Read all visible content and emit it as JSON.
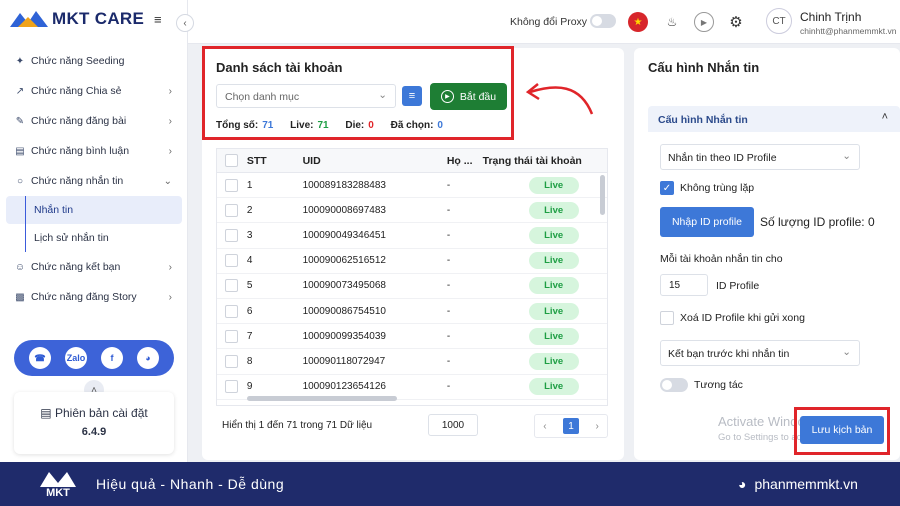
{
  "app": {
    "name": "MKT CARE"
  },
  "sidebar": {
    "items": [
      {
        "label": "Chức năng Seeding",
        "icon": "seeding-icon"
      },
      {
        "label": "Chức năng Chia sẻ",
        "icon": "share-icon"
      },
      {
        "label": "Chức năng đăng bài",
        "icon": "post-icon"
      },
      {
        "label": "Chức năng bình luận",
        "icon": "comment-icon"
      },
      {
        "label": "Chức năng nhắn tin",
        "icon": "message-icon"
      },
      {
        "label": "Chức năng kết bạn",
        "icon": "add-friend-icon"
      },
      {
        "label": "Chức năng đăng Story",
        "icon": "story-icon"
      }
    ],
    "sub_items": [
      {
        "label": "Nhắn tin"
      },
      {
        "label": "Lịch sử nhắn tin"
      }
    ],
    "version_label": "Phiên bản cài đặt",
    "version": "6.4.9"
  },
  "topbar": {
    "proxy_label": "Không đổi Proxy",
    "avatar_initials": "CT",
    "user_name": "Chinh Trịnh",
    "user_email": "chinhtt@phanmemmkt.vn"
  },
  "accounts": {
    "title": "Danh sách tài khoản",
    "category_placeholder": "Chọn danh mục",
    "start_label": "Bắt đầu",
    "stats": {
      "total_label": "Tổng số:",
      "total": "71",
      "live_label": "Live:",
      "live": "71",
      "die_label": "Die:",
      "die": "0",
      "selected_label": "Đã chọn:",
      "selected": "0"
    },
    "columns": [
      "STT",
      "UID",
      "Họ ...",
      "Trạng thái tài khoản"
    ],
    "rows": [
      {
        "stt": "1",
        "uid": "100089183288483",
        "name": "-",
        "status": "Live"
      },
      {
        "stt": "2",
        "uid": "100090008697483",
        "name": "-",
        "status": "Live"
      },
      {
        "stt": "3",
        "uid": "100090049346451",
        "name": "-",
        "status": "Live"
      },
      {
        "stt": "4",
        "uid": "100090062516512",
        "name": "-",
        "status": "Live"
      },
      {
        "stt": "5",
        "uid": "100090073495068",
        "name": "-",
        "status": "Live"
      },
      {
        "stt": "6",
        "uid": "100090086754510",
        "name": "-",
        "status": "Live"
      },
      {
        "stt": "7",
        "uid": "100090099354039",
        "name": "-",
        "status": "Live"
      },
      {
        "stt": "8",
        "uid": "100090118072947",
        "name": "-",
        "status": "Live"
      },
      {
        "stt": "9",
        "uid": "100090123654126",
        "name": "-",
        "status": "Live"
      }
    ],
    "footer_text": "Hiển thị 1 đến 71 trong 71 Dữ liệu",
    "page_size": "1000",
    "current_page": "1"
  },
  "config": {
    "title": "Cấu hình Nhắn tin",
    "section_title": "Cấu hình Nhắn tin",
    "message_type": "Nhắn tin theo ID Profile",
    "no_duplicate_label": "Không trùng lặp",
    "import_label": "Nhập ID profile",
    "profile_count_label": "Số lượng ID profile: 0",
    "per_account_label": "Mỗi tài khoản nhắn tin cho",
    "per_account_value": "15",
    "per_account_unit": "ID Profile",
    "delete_label": "Xoá ID Profile khi gửi xong",
    "friend_option": "Kết bạn trước khi nhắn tin",
    "interact_label": "Tương tác",
    "save_label": "Lưu kịch bản"
  },
  "watermark": {
    "line1": "Activate Windows",
    "line2": "Go to Settings to activate Windows."
  },
  "banner": {
    "logo_text": "MKT",
    "tagline": "Hiệu quả - Nhanh - Dễ dùng",
    "site": "phanmemmkt.vn"
  },
  "colors": {
    "primary": "#3d78d8",
    "start_green": "#1e7e34",
    "live_bg": "#d6f5dd",
    "live_text": "#1e9e44",
    "highlight_red": "#e0252a",
    "banner_bg": "#1f2b6b"
  }
}
